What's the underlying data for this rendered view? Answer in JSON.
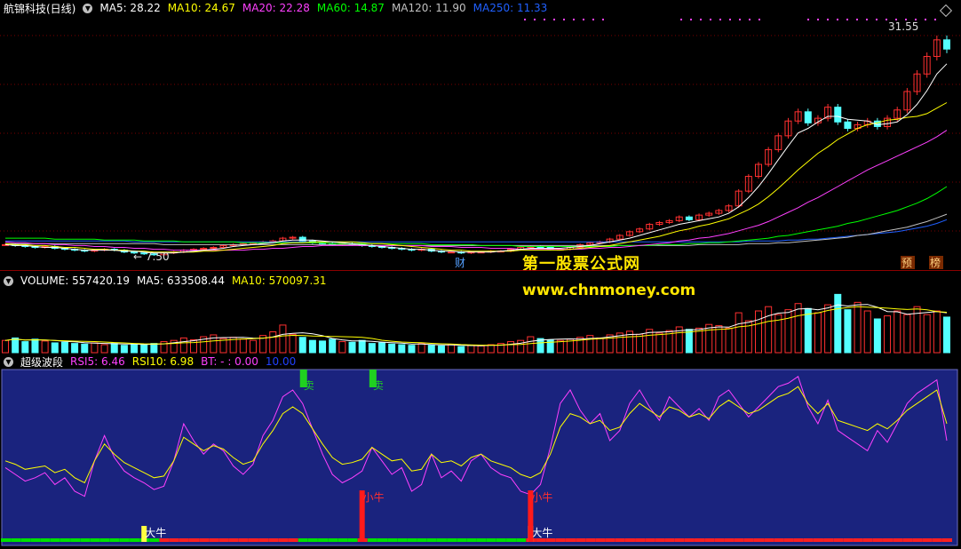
{
  "price_panel": {
    "title": "航锦科技(日线)",
    "ma_items": [
      {
        "label": "MA5: 28.22",
        "color": "#ffffff"
      },
      {
        "label": "MA10: 24.67",
        "color": "#ffff00"
      },
      {
        "label": "MA20: 22.28",
        "color": "#ff40ff"
      },
      {
        "label": "MA60: 14.87",
        "color": "#00ff00"
      },
      {
        "label": "MA120: 11.90",
        "color": "#c0c0c0"
      },
      {
        "label": "MA250: 11.33",
        "color": "#2060ff"
      }
    ],
    "high_label": "31.55",
    "low_label": "7.50",
    "marker_cai": "财",
    "marker_yu": "预",
    "marker_bang": "榜"
  },
  "watermark": {
    "line1": "第一股票公式网",
    "line2": "www.chnmoney.com"
  },
  "volume_panel": {
    "items": [
      {
        "label": "VOLUME: 557420.19",
        "color": "#ffffff"
      },
      {
        "label": "MA5: 633508.44",
        "color": "#ffffff"
      },
      {
        "label": "MA10: 570097.31",
        "color": "#ffff00"
      }
    ]
  },
  "indicator_panel": {
    "title": "超级波段",
    "items": [
      {
        "label": "RSI5: 6.46",
        "color": "#ff40ff"
      },
      {
        "label": "RSI10: 6.98",
        "color": "#ffff00"
      },
      {
        "label": "BT: - : 0.00",
        "color": "#ff40ff"
      },
      {
        "label": "10.00",
        "color": "#2040ff"
      }
    ],
    "signals": {
      "sell": "卖",
      "small_bull": "小牛",
      "big_bull": "大牛"
    }
  },
  "chart_data": {
    "type": "line",
    "price": {
      "close": [
        8.6,
        8.5,
        8.4,
        8.3,
        8.4,
        8.2,
        8.1,
        8.0,
        7.9,
        8.0,
        8.1,
        8.0,
        7.8,
        7.7,
        7.6,
        7.5,
        7.7,
        7.8,
        8.0,
        8.1,
        8.2,
        8.3,
        8.5,
        8.6,
        8.7,
        8.8,
        8.9,
        9.0,
        9.3,
        9.4,
        9.0,
        8.8,
        8.7,
        8.6,
        8.7,
        8.6,
        8.5,
        8.4,
        8.3,
        8.2,
        8.1,
        8.0,
        8.1,
        7.9,
        7.8,
        7.8,
        7.7,
        7.8,
        7.8,
        7.9,
        7.9,
        8.1,
        8.3,
        8.4,
        8.3,
        8.1,
        8.1,
        8.3,
        8.6,
        8.8,
        8.9,
        9.2,
        9.6,
        10.0,
        10.3,
        10.8,
        11.0,
        11.2,
        11.6,
        11.3,
        11.8,
        12.0,
        12.3,
        12.8,
        14.4,
        16.0,
        17.3,
        18.9,
        20.4,
        22.0,
        23.0,
        21.8,
        22.3,
        23.5,
        21.9,
        21.2,
        21.6,
        22.0,
        21.4,
        22.3,
        23.2,
        25.2,
        27.1,
        29.0,
        30.8,
        29.8
      ],
      "ma5": [
        8.6,
        8.5,
        8.5,
        8.4,
        8.3,
        8.3,
        8.2,
        8.1,
        8.0,
        8.0,
        8.0,
        8.0,
        7.9,
        7.9,
        7.8,
        7.7,
        7.7,
        7.7,
        7.8,
        7.9,
        8.0,
        8.1,
        8.2,
        8.4,
        8.5,
        8.6,
        8.7,
        8.8,
        9.0,
        9.1,
        9.1,
        9.1,
        9.0,
        8.9,
        8.8,
        8.7,
        8.6,
        8.5,
        8.4,
        8.3,
        8.2,
        8.1,
        8.1,
        8.0,
        7.9,
        7.9,
        7.8,
        7.8,
        7.8,
        7.8,
        7.9,
        8.0,
        8.1,
        8.2,
        8.2,
        8.2,
        8.2,
        8.3,
        8.4,
        8.5,
        8.7,
        8.9,
        9.1,
        9.3,
        9.6,
        9.9,
        10.2,
        10.5,
        10.8,
        11.0,
        11.2,
        11.4,
        11.6,
        12.0,
        12.7,
        13.7,
        14.9,
        16.3,
        17.8,
        19.3,
        20.7,
        21.2,
        21.9,
        22.5,
        22.5,
        22.2,
        22.1,
        22.0,
        21.6,
        21.7,
        21.9,
        22.7,
        23.8,
        25.3,
        27.1,
        28.2
      ],
      "ma10": [
        8.7,
        8.6,
        8.6,
        8.5,
        8.5,
        8.4,
        8.3,
        8.3,
        8.2,
        8.1,
        8.1,
        8.0,
        8.0,
        7.9,
        7.9,
        7.8,
        7.8,
        7.8,
        7.8,
        7.8,
        7.9,
        7.9,
        8.0,
        8.1,
        8.2,
        8.3,
        8.4,
        8.5,
        8.7,
        8.8,
        8.8,
        8.9,
        8.9,
        8.9,
        8.9,
        8.9,
        8.8,
        8.7,
        8.7,
        8.6,
        8.5,
        8.4,
        8.3,
        8.2,
        8.1,
        8.0,
        8.0,
        7.9,
        7.9,
        7.9,
        7.9,
        7.9,
        8.0,
        8.0,
        8.0,
        8.0,
        8.0,
        8.1,
        8.2,
        8.3,
        8.4,
        8.5,
        8.7,
        8.9,
        9.1,
        9.3,
        9.5,
        9.8,
        10.1,
        10.3,
        10.6,
        10.8,
        11.1,
        11.4,
        11.9,
        12.4,
        13.0,
        13.8,
        14.7,
        15.7,
        16.7,
        17.6,
        18.5,
        19.2,
        20.0,
        20.6,
        21.2,
        21.6,
        21.8,
        22.1,
        22.2,
        22.4,
        22.5,
        22.8,
        23.4,
        24.0
      ],
      "ma20": [
        8.9,
        8.8,
        8.8,
        8.7,
        8.7,
        8.6,
        8.6,
        8.5,
        8.5,
        8.4,
        8.4,
        8.3,
        8.3,
        8.2,
        8.2,
        8.1,
        8.1,
        8.0,
        8.0,
        8.0,
        8.0,
        8.0,
        8.0,
        8.0,
        8.0,
        8.1,
        8.1,
        8.2,
        8.2,
        8.3,
        8.4,
        8.4,
        8.5,
        8.5,
        8.5,
        8.5,
        8.5,
        8.5,
        8.5,
        8.5,
        8.5,
        8.5,
        8.5,
        8.4,
        8.4,
        8.4,
        8.3,
        8.3,
        8.3,
        8.2,
        8.2,
        8.2,
        8.1,
        8.1,
        8.1,
        8.1,
        8.1,
        8.1,
        8.1,
        8.2,
        8.2,
        8.3,
        8.3,
        8.4,
        8.5,
        8.6,
        8.7,
        8.8,
        9.0,
        9.1,
        9.3,
        9.4,
        9.6,
        9.8,
        10.1,
        10.4,
        10.7,
        11.1,
        11.6,
        12.1,
        12.6,
        13.2,
        13.7,
        14.3,
        14.9,
        15.5,
        16.1,
        16.7,
        17.2,
        17.7,
        18.2,
        18.7,
        19.2,
        19.7,
        20.3,
        21.0
      ],
      "ma60": [
        9.3,
        9.3,
        9.3,
        9.3,
        9.3,
        9.2,
        9.2,
        9.2,
        9.2,
        9.2,
        9.1,
        9.1,
        9.1,
        9.1,
        9.0,
        9.0,
        9.0,
        9.0,
        8.9,
        8.9,
        8.9,
        8.9,
        8.9,
        8.9,
        8.8,
        8.8,
        8.8,
        8.8,
        8.8,
        8.8,
        8.8,
        8.8,
        8.8,
        8.7,
        8.7,
        8.7,
        8.7,
        8.7,
        8.7,
        8.7,
        8.7,
        8.7,
        8.7,
        8.6,
        8.6,
        8.6,
        8.6,
        8.6,
        8.5,
        8.5,
        8.5,
        8.5,
        8.4,
        8.4,
        8.4,
        8.4,
        8.4,
        8.4,
        8.4,
        8.4,
        8.4,
        8.4,
        8.5,
        8.5,
        8.5,
        8.5,
        8.6,
        8.6,
        8.6,
        8.7,
        8.7,
        8.8,
        8.8,
        8.9,
        9.0,
        9.1,
        9.2,
        9.3,
        9.5,
        9.6,
        9.8,
        10.0,
        10.2,
        10.4,
        10.6,
        10.9,
        11.1,
        11.4,
        11.7,
        12.0,
        12.3,
        12.7,
        13.1,
        13.6,
        14.2,
        14.9
      ],
      "ma120": [
        8.7,
        8.7,
        8.7,
        8.7,
        8.7,
        8.7,
        8.7,
        8.7,
        8.7,
        8.7,
        8.7,
        8.7,
        8.7,
        8.7,
        8.7,
        8.7,
        8.6,
        8.6,
        8.6,
        8.6,
        8.6,
        8.6,
        8.6,
        8.6,
        8.6,
        8.6,
        8.6,
        8.6,
        8.6,
        8.6,
        8.6,
        8.6,
        8.6,
        8.6,
        8.6,
        8.6,
        8.6,
        8.5,
        8.5,
        8.5,
        8.5,
        8.5,
        8.5,
        8.5,
        8.5,
        8.5,
        8.5,
        8.5,
        8.5,
        8.5,
        8.5,
        8.5,
        8.5,
        8.5,
        8.5,
        8.5,
        8.5,
        8.5,
        8.5,
        8.5,
        8.5,
        8.5,
        8.5,
        8.5,
        8.5,
        8.5,
        8.5,
        8.5,
        8.5,
        8.5,
        8.6,
        8.6,
        8.6,
        8.6,
        8.6,
        8.7,
        8.7,
        8.7,
        8.8,
        8.8,
        8.9,
        9.0,
        9.1,
        9.2,
        9.3,
        9.4,
        9.6,
        9.7,
        9.9,
        10.1,
        10.3,
        10.5,
        10.8,
        11.1,
        11.5,
        11.9
      ],
      "ma250": [
        9.0,
        9.0,
        9.0,
        9.0,
        9.0,
        9.0,
        9.0,
        9.0,
        9.0,
        9.0,
        9.0,
        9.0,
        9.0,
        8.9,
        8.9,
        8.9,
        8.9,
        8.9,
        8.9,
        8.9,
        8.9,
        8.9,
        8.9,
        8.9,
        8.9,
        8.9,
        8.9,
        8.9,
        8.9,
        8.9,
        8.9,
        8.9,
        8.9,
        8.9,
        8.9,
        8.9,
        8.9,
        8.9,
        8.9,
        8.9,
        8.9,
        8.9,
        8.9,
        8.9,
        8.9,
        8.9,
        8.9,
        8.9,
        8.9,
        8.9,
        8.9,
        8.9,
        8.9,
        8.9,
        8.9,
        8.9,
        8.9,
        8.9,
        8.9,
        8.9,
        8.9,
        8.9,
        8.9,
        8.9,
        8.9,
        8.9,
        8.9,
        8.9,
        8.9,
        8.9,
        8.9,
        8.9,
        8.9,
        8.9,
        8.9,
        9.0,
        9.0,
        9.0,
        9.0,
        9.1,
        9.1,
        9.2,
        9.2,
        9.3,
        9.4,
        9.5,
        9.6,
        9.7,
        9.8,
        9.9,
        10.0,
        10.2,
        10.4,
        10.6,
        10.9,
        11.3
      ],
      "ylim": [
        7.0,
        33.0
      ]
    },
    "volume": {
      "values": [
        2.0,
        2.4,
        1.8,
        2.2,
        1.9,
        1.6,
        1.7,
        1.5,
        1.4,
        1.6,
        1.3,
        1.5,
        1.2,
        1.4,
        1.3,
        1.5,
        1.8,
        2.0,
        2.4,
        2.1,
        2.6,
        2.9,
        2.3,
        2.5,
        2.2,
        2.0,
        2.8,
        3.4,
        4.5,
        3.0,
        2.5,
        2.0,
        1.9,
        2.2,
        1.8,
        1.7,
        2.0,
        1.5,
        1.6,
        1.4,
        1.3,
        1.2,
        1.5,
        1.2,
        1.1,
        1.3,
        1.0,
        1.2,
        1.1,
        1.3,
        1.5,
        1.8,
        2.0,
        2.6,
        2.3,
        2.1,
        2.0,
        2.2,
        2.5,
        2.8,
        2.4,
        2.9,
        3.2,
        3.5,
        3.0,
        3.8,
        3.2,
        3.6,
        4.2,
        3.8,
        4.0,
        4.6,
        4.4,
        4.0,
        6.5,
        5.2,
        6.8,
        7.5,
        6.2,
        7.0,
        8.0,
        7.2,
        6.5,
        7.8,
        9.5,
        7.0,
        8.2,
        6.8,
        5.5,
        6.0,
        6.8,
        6.2,
        7.5,
        6.2,
        6.8,
        5.8
      ],
      "ylim": [
        0,
        11
      ]
    },
    "indicator": {
      "rsi5": [
        44,
        40,
        36,
        38,
        41,
        34,
        38,
        30,
        27,
        48,
        63,
        50,
        42,
        38,
        35,
        31,
        33,
        48,
        70,
        60,
        52,
        58,
        54,
        45,
        40,
        46,
        63,
        72,
        86,
        90,
        82,
        67,
        52,
        40,
        35,
        38,
        42,
        56,
        48,
        40,
        44,
        30,
        34,
        52,
        38,
        42,
        36,
        48,
        52,
        44,
        40,
        38,
        30,
        28,
        34,
        56,
        82,
        90,
        78,
        70,
        76,
        60,
        66,
        82,
        90,
        80,
        72,
        86,
        80,
        74,
        79,
        72,
        86,
        90,
        82,
        74,
        80,
        86,
        92,
        94,
        98,
        80,
        70,
        84,
        66,
        62,
        58,
        54,
        66,
        59,
        70,
        82,
        88,
        92,
        96,
        60
      ],
      "rsi10": [
        48,
        46,
        43,
        44,
        45,
        41,
        43,
        38,
        35,
        48,
        58,
        52,
        47,
        44,
        41,
        38,
        39,
        48,
        62,
        58,
        54,
        57,
        55,
        50,
        46,
        48,
        58,
        66,
        76,
        80,
        76,
        67,
        58,
        50,
        46,
        47,
        49,
        56,
        52,
        48,
        49,
        42,
        43,
        52,
        47,
        48,
        45,
        50,
        52,
        48,
        46,
        44,
        40,
        38,
        41,
        52,
        68,
        76,
        74,
        70,
        72,
        66,
        68,
        76,
        82,
        78,
        74,
        80,
        78,
        74,
        76,
        73,
        80,
        84,
        80,
        76,
        78,
        82,
        86,
        88,
        92,
        82,
        76,
        82,
        72,
        70,
        68,
        66,
        70,
        67,
        72,
        78,
        82,
        86,
        90,
        70
      ],
      "ylim": [
        0,
        100
      ]
    }
  }
}
